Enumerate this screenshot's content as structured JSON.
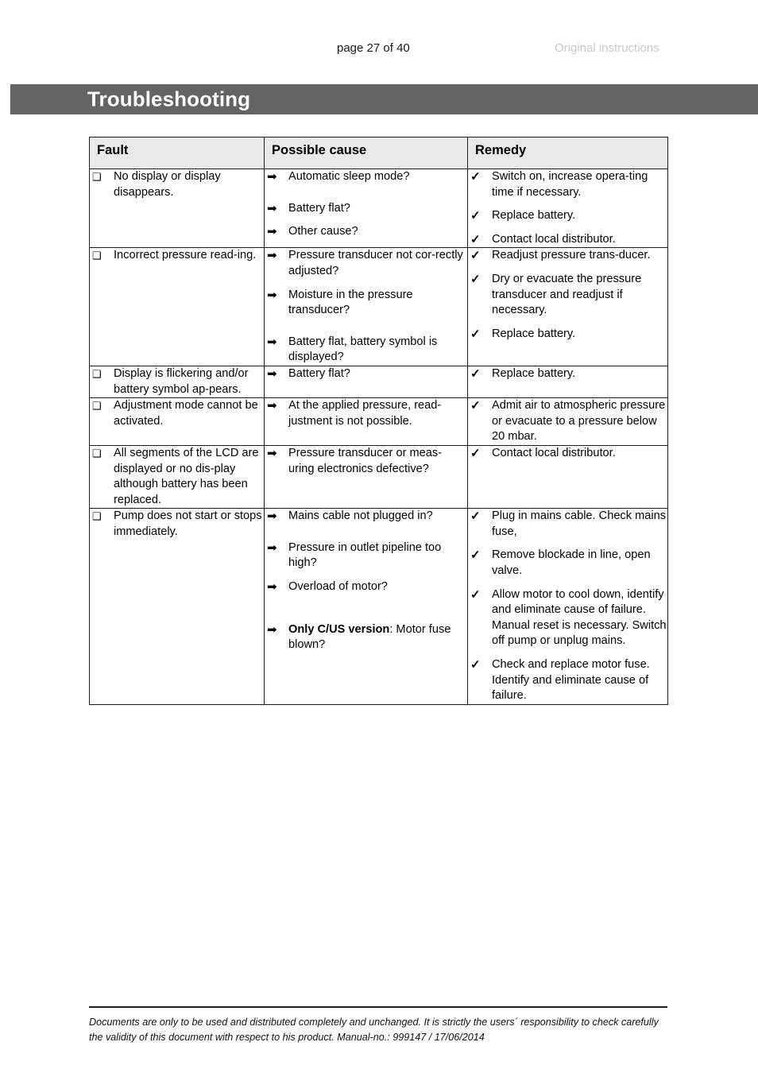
{
  "header": {
    "page_number": "page 27 of 40",
    "original_instructions": "Original instructions"
  },
  "title_bar": {
    "title": "Troubleshooting",
    "background_color": "#646464",
    "text_color": "#ffffff"
  },
  "table": {
    "columns": [
      "Fault",
      "Possible cause",
      "Remedy"
    ],
    "header_background": "#e9e9e9",
    "markers": {
      "fault": "❑",
      "cause": "➡",
      "remedy": "✓"
    },
    "rows": [
      {
        "fault": [
          "No display or display disappears."
        ],
        "causes": [
          {
            "text": "Automatic sleep mode?",
            "gap": ""
          },
          {
            "text": "Battery flat?",
            "gap": "gap-md"
          },
          {
            "text": "Other cause?",
            "gap": "gap-sm"
          }
        ],
        "remedies": [
          {
            "text": "Switch on, increase opera-ting time if necessary.",
            "gap": ""
          },
          {
            "text": "Replace battery.",
            "gap": "gap-sm"
          },
          {
            "text": "Contact local distributor.",
            "gap": "gap-sm"
          }
        ]
      },
      {
        "fault": [
          "Incorrect pressure read-ing."
        ],
        "causes": [
          {
            "text": "Pressure transducer not cor-rectly adjusted?",
            "gap": ""
          },
          {
            "text": "Moisture in the pressure transducer?",
            "gap": "gap-sm"
          },
          {
            "text": "Battery flat, battery symbol is displayed?",
            "gap": "gap-md"
          }
        ],
        "remedies": [
          {
            "text": "Readjust pressure trans-ducer.",
            "gap": ""
          },
          {
            "text": "Dry or evacuate the pressure transducer and readjust if necessary.",
            "gap": "gap-sm"
          },
          {
            "text": "Replace battery.",
            "gap": "gap-sm"
          }
        ]
      },
      {
        "fault": [
          "Display is flickering and/or battery symbol ap-pears."
        ],
        "causes": [
          {
            "text": "Battery flat?",
            "gap": ""
          }
        ],
        "remedies": [
          {
            "text": "Replace battery.",
            "gap": ""
          }
        ]
      },
      {
        "fault": [
          "Adjustment mode cannot be activated."
        ],
        "causes": [
          {
            "text": "At the applied pressure, read-justment is not possible.",
            "gap": ""
          }
        ],
        "remedies": [
          {
            "text": "Admit air to atmospheric pressure or evacuate to a pressure below 20 mbar.",
            "gap": ""
          }
        ]
      },
      {
        "fault": [
          "All segments of the LCD are displayed or no dis-play although battery has been replaced."
        ],
        "causes": [
          {
            "text": "Pressure transducer or meas-uring electronics defective?",
            "gap": ""
          }
        ],
        "remedies": [
          {
            "text": "Contact local distributor.",
            "gap": ""
          }
        ]
      },
      {
        "fault": [
          "Pump does not start or stops immediately."
        ],
        "causes": [
          {
            "text": "Mains cable not plugged in?",
            "gap": ""
          },
          {
            "text": "Pressure in outlet pipeline too high?",
            "gap": "gap-md"
          },
          {
            "text": "Overload of motor?",
            "gap": "gap-sm"
          },
          {
            "text": "Motor fuse blown?",
            "bold_prefix": "Only C/US version",
            "bold_suffix": ":",
            "gap": "gap-lg"
          }
        ],
        "remedies": [
          {
            "text": "Plug in mains cable. Check mains fuse,",
            "gap": ""
          },
          {
            "text": "Remove blockade in line, open valve.",
            "gap": "gap-sm"
          },
          {
            "text": "Allow motor to cool down, identify and eliminate cause of failure. Manual reset is necessary. Switch off pump or unplug mains.",
            "gap": "gap-sm"
          },
          {
            "text": "Check and replace motor fuse. Identify and eliminate cause of failure.",
            "gap": "gap-sm"
          }
        ]
      }
    ]
  },
  "footer": {
    "text": "Documents are only to be used and distributed completely and unchanged. It is strictly the users´ responsibility to check carefully the validity of this document with respect to his product. Manual-no.: 999147 / 17/06/2014"
  }
}
